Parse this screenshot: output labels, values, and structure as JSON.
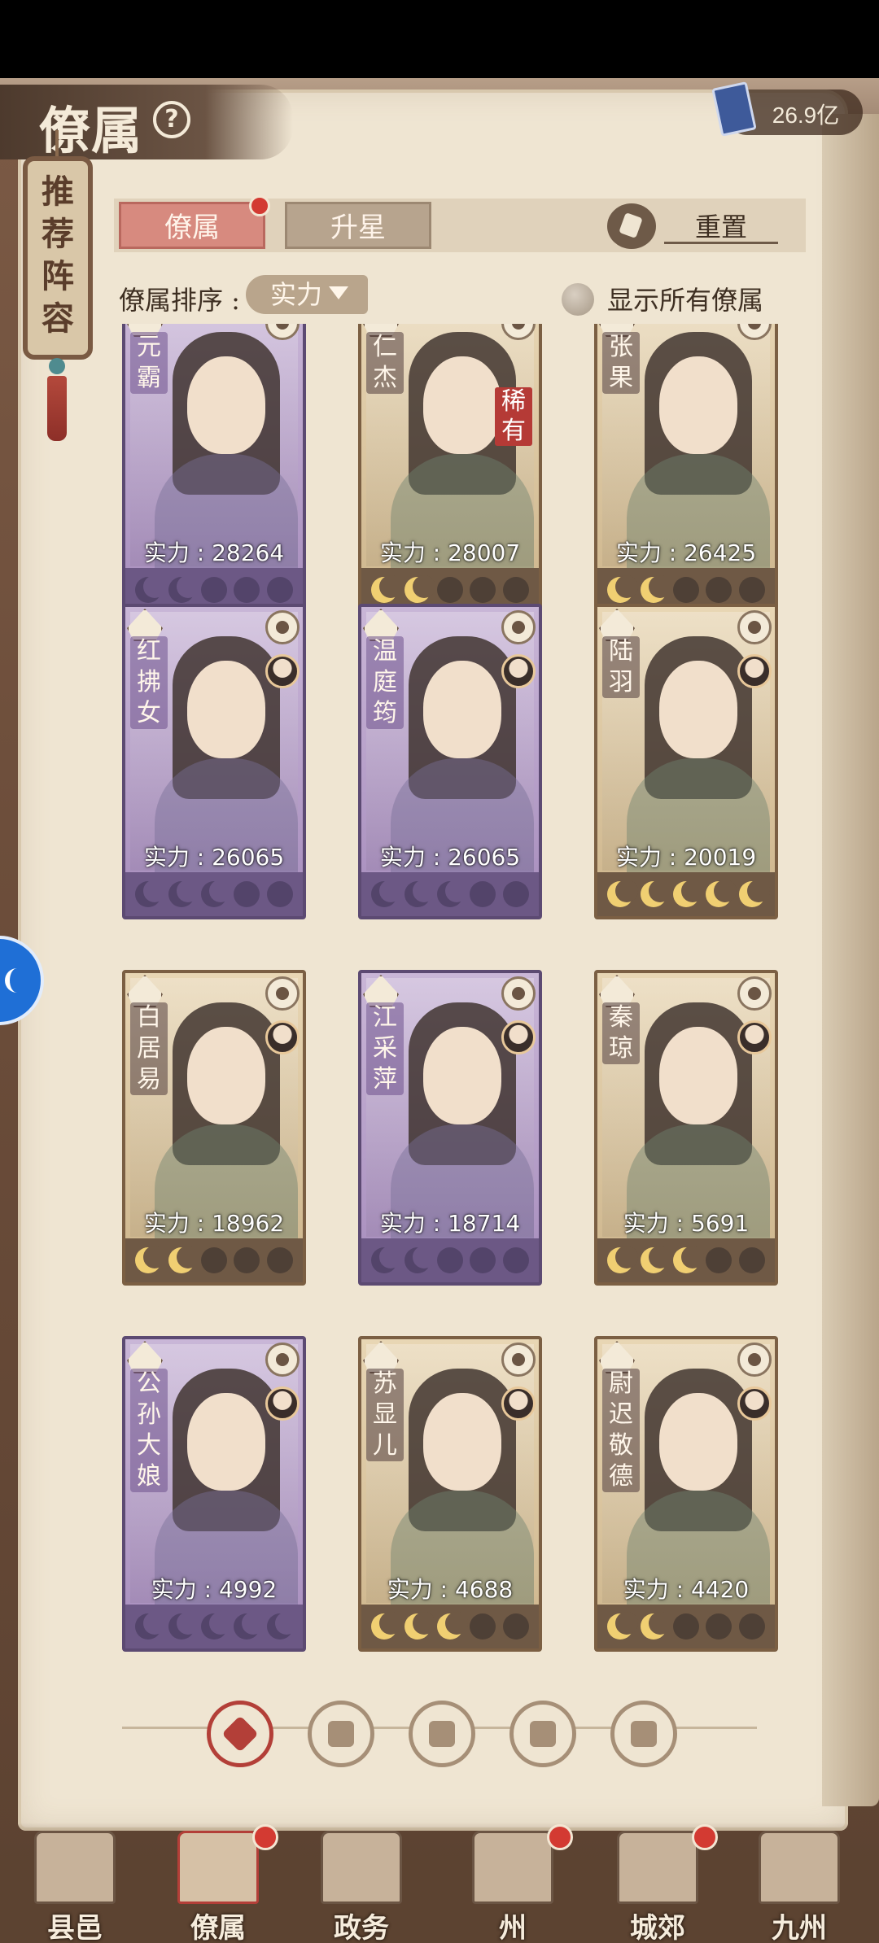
{
  "header": {
    "title": "僚属",
    "currency_value": "26.9亿"
  },
  "banner": {
    "text": "推荐阵容"
  },
  "tabs": [
    {
      "label": "僚属",
      "active": true,
      "has_dot": true
    },
    {
      "label": "升星",
      "active": false,
      "has_dot": false
    }
  ],
  "reset_label": "重置",
  "sort": {
    "label": "僚属排序 :",
    "selected": "实力"
  },
  "show_all_label": "显示所有僚属",
  "cards": [
    {
      "name": "元霸",
      "power": "实力 : 28264",
      "stars": 2,
      "color": "purple",
      "rarity": ""
    },
    {
      "name": "仁杰",
      "power": "实力 : 28007",
      "stars": 2,
      "color": "tan",
      "rarity": "稀有"
    },
    {
      "name": "张果",
      "power": "实力 : 26425",
      "stars": 2,
      "color": "tan",
      "rarity": ""
    },
    {
      "name": "红拂女",
      "power": "实力 : 26065",
      "stars": 3,
      "color": "purple",
      "rarity": ""
    },
    {
      "name": "温庭筠",
      "power": "实力 : 26065",
      "stars": 3,
      "color": "purple",
      "rarity": ""
    },
    {
      "name": "陆羽",
      "power": "实力 : 20019",
      "stars": 5,
      "color": "tan",
      "rarity": ""
    },
    {
      "name": "白居易",
      "power": "实力 : 18962",
      "stars": 2,
      "color": "tan",
      "rarity": ""
    },
    {
      "name": "江采萍",
      "power": "实力 : 18714",
      "stars": 2,
      "color": "purple",
      "rarity": ""
    },
    {
      "name": "秦琼",
      "power": "实力 : 5691",
      "stars": 3,
      "color": "tan",
      "rarity": ""
    },
    {
      "name": "公孙大娘",
      "power": "实力 : 4992",
      "stars": 5,
      "color": "purple",
      "rarity": ""
    },
    {
      "name": "苏显儿",
      "power": "实力 : 4688",
      "stars": 3,
      "color": "tan",
      "rarity": ""
    },
    {
      "name": "尉迟敬德",
      "power": "实力 : 4420",
      "stars": 2,
      "color": "tan",
      "rarity": ""
    }
  ],
  "filters": [
    "all-icon",
    "temple-bell-icon",
    "gourd-icon",
    "fan-icon",
    "lion-icon"
  ],
  "nav": [
    {
      "label": "县邑",
      "has_dot": false,
      "active": false
    },
    {
      "label": "僚属",
      "has_dot": true,
      "active": true
    },
    {
      "label": "政务",
      "has_dot": false,
      "active": false
    },
    {
      "label": "州",
      "has_dot": true,
      "active": false
    },
    {
      "label": "城郊",
      "has_dot": true,
      "active": false
    },
    {
      "label": "九州",
      "has_dot": false,
      "active": false
    }
  ]
}
